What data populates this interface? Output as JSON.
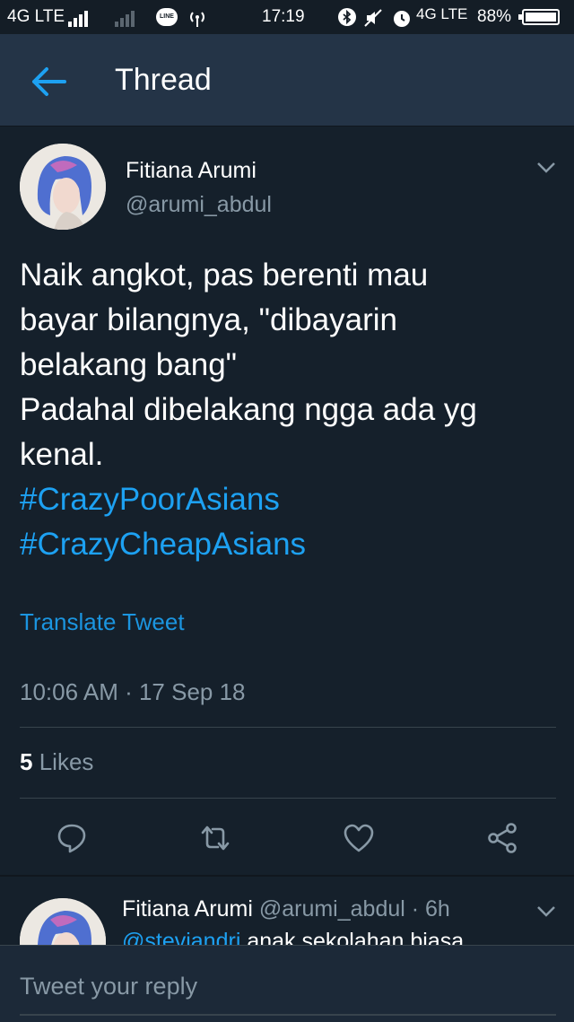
{
  "status_bar": {
    "network_left": "4G LTE",
    "line_label": "LINE",
    "time": "17:19",
    "network_right": "4G LTE",
    "battery": "88%"
  },
  "header": {
    "title": "Thread",
    "back_icon": "arrow-left-icon"
  },
  "tweet": {
    "author_name": "Fitiana Arumi",
    "author_handle": "@arumi_abdul",
    "text_lines": [
      "Naik angkot, pas berenti mau",
      "bayar bilangnya, \"dibayarin",
      "belakang bang\"",
      "Padahal dibelakang ngga ada yg",
      "kenal."
    ],
    "hashtags": [
      "#CrazyPoorAsians",
      "#CrazyCheapAsians"
    ],
    "translate_label": "Translate Tweet",
    "timestamp": "10:06 AM · 17 Sep 18",
    "likes_count": "5",
    "likes_label": "Likes",
    "actions": [
      "reply-icon",
      "retweet-icon",
      "like-icon",
      "share-icon"
    ]
  },
  "reply": {
    "author_name": "Fitiana Arumi",
    "meta": "@arumi_abdul · 6h",
    "mention": "@steviandri",
    "text": "anak sekolahan biasa..."
  },
  "composer": {
    "placeholder": "Tweet your reply"
  },
  "colors": {
    "background": "#15202b",
    "header": "#243447",
    "accent": "#1da1f2",
    "secondary_text": "#8899a6",
    "divider": "#38444d"
  }
}
